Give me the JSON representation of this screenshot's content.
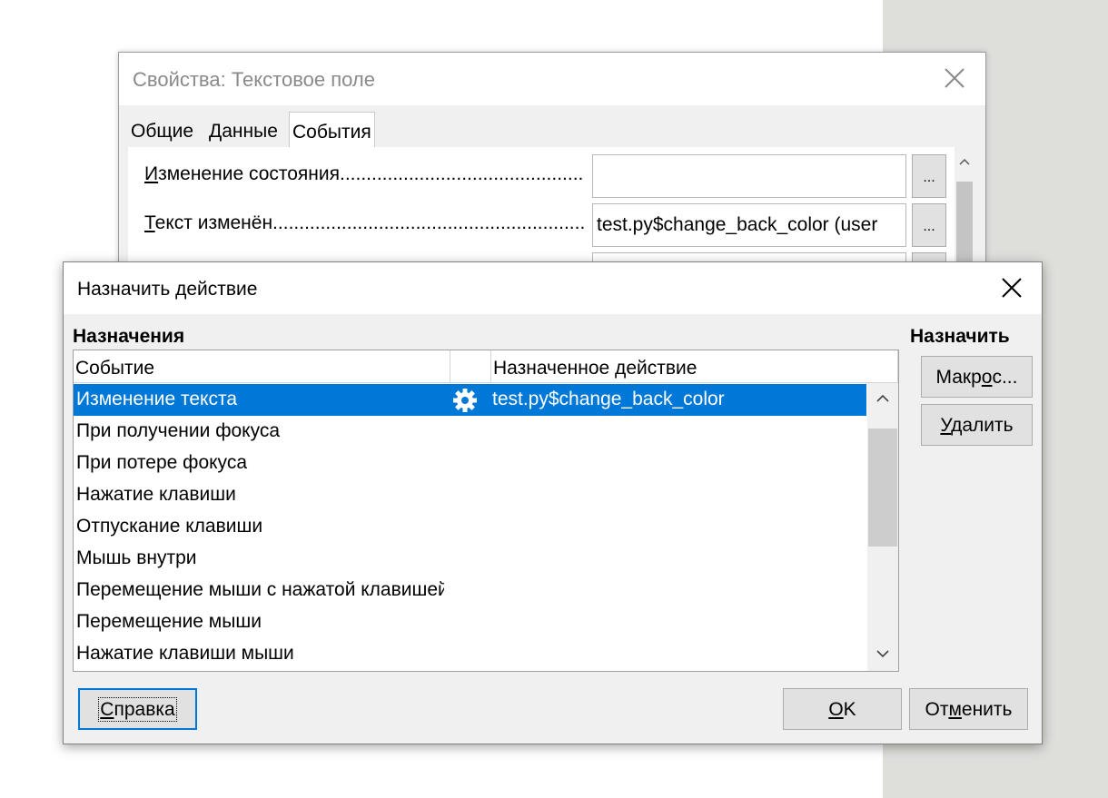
{
  "properties_dialog": {
    "title": "Свойства: Текстовое поле",
    "tabs": [
      "Общие",
      "Данные",
      "События"
    ],
    "active_tab": "События",
    "events": [
      {
        "label": "Изменение состояния.......................................................................",
        "value": "",
        "button": "..."
      },
      {
        "label": "Текст изменён...............................................................................",
        "value": "test.py$change_back_color (user",
        "button": "..."
      },
      {
        "label": "",
        "value": "",
        "button": ""
      }
    ]
  },
  "assign_dialog": {
    "title": "Назначить действие",
    "assignments_label": "Назначения",
    "assign_label": "Назначить",
    "columns": {
      "event": "Событие",
      "icon": "",
      "action": "Назначенное действие"
    },
    "rows": [
      {
        "event": "Изменение текста",
        "action": "test.py$change_back_color",
        "icon": "gear-icon",
        "selected": true
      },
      {
        "event": "При получении фокуса",
        "action": "",
        "selected": false
      },
      {
        "event": "При потере фокуса",
        "action": "",
        "selected": false
      },
      {
        "event": "Нажатие клавиши",
        "action": "",
        "selected": false
      },
      {
        "event": "Отпускание клавиши",
        "action": "",
        "selected": false
      },
      {
        "event": "Мышь внутри",
        "action": "",
        "selected": false
      },
      {
        "event": "Перемещение мыши с нажатой клавишей",
        "action": "",
        "selected": false
      },
      {
        "event": "Перемещение мыши",
        "action": "",
        "selected": false
      },
      {
        "event": "Нажатие клавиши мыши",
        "action": "",
        "selected": false
      }
    ],
    "buttons": {
      "macro": {
        "pre": "Макр",
        "ul": "о",
        "post": "с..."
      },
      "delete": {
        "pre": "",
        "ul": "У",
        "post": "далить"
      },
      "help": {
        "pre": "",
        "ul": "С",
        "post": "правка"
      },
      "ok": {
        "pre": "",
        "ul": "О",
        "post": "K"
      },
      "cancel": {
        "pre": "От",
        "ul": "м",
        "post": "енить"
      }
    }
  },
  "colors": {
    "selection": "#0078d7",
    "dialog_bg": "#f0f0f0",
    "right_panel_bg": "#dededb"
  }
}
